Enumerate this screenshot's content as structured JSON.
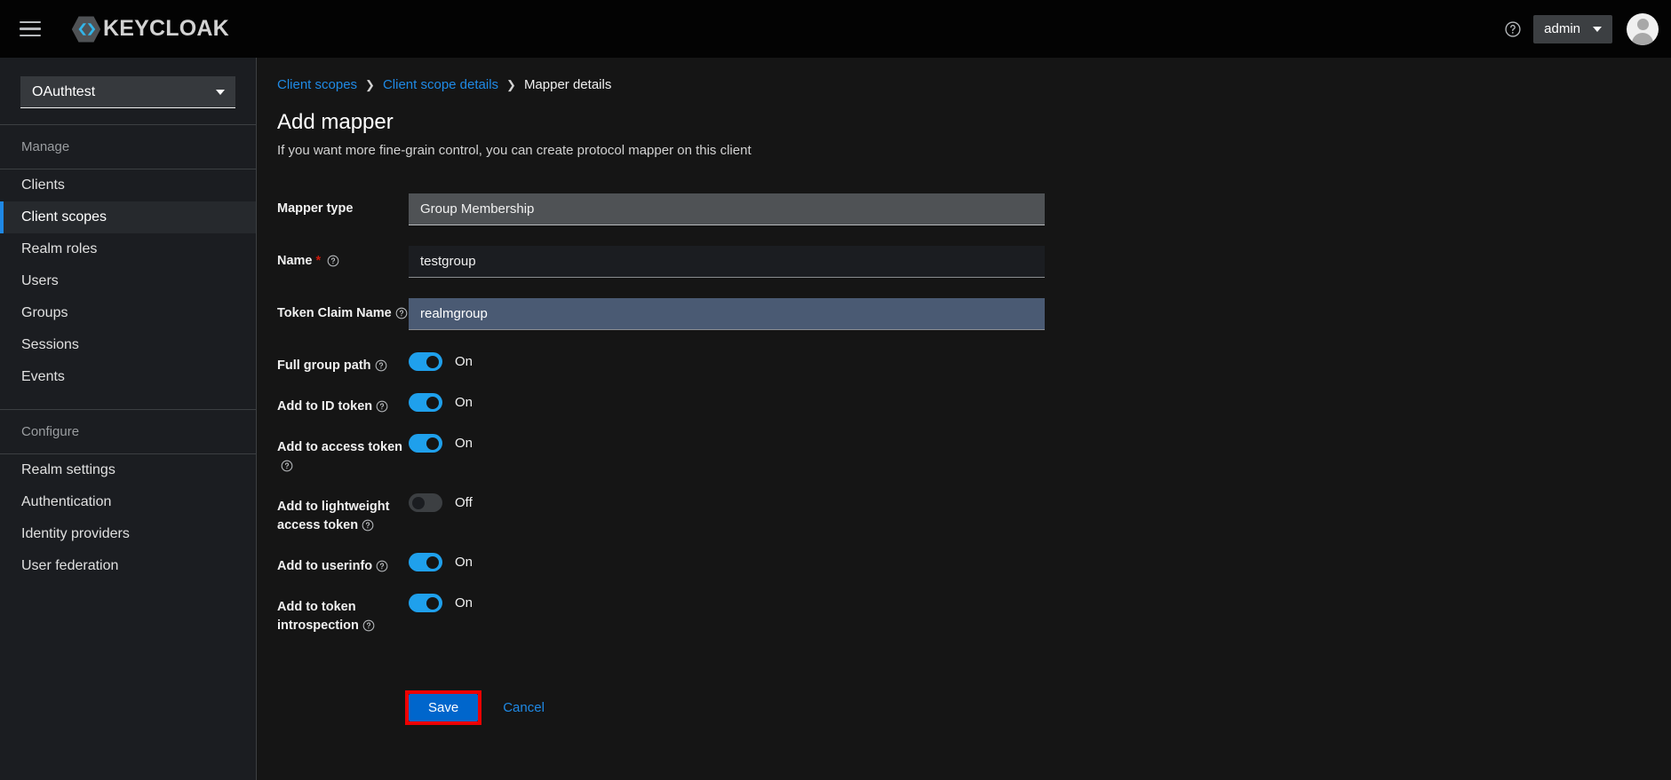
{
  "masthead": {
    "menu_icon": "hamburger-icon",
    "brand_name": "KEYCLOAK",
    "help_icon": "help-circle-icon",
    "user_name": "admin",
    "avatar_icon": "user-avatar-icon"
  },
  "sidebar": {
    "realm": {
      "selected": "OAuthtest",
      "caret_icon": "chevron-down-icon"
    },
    "manage": {
      "label": "Manage",
      "items": [
        {
          "label": "Clients",
          "active": false
        },
        {
          "label": "Client scopes",
          "active": true
        },
        {
          "label": "Realm roles",
          "active": false
        },
        {
          "label": "Users",
          "active": false
        },
        {
          "label": "Groups",
          "active": false
        },
        {
          "label": "Sessions",
          "active": false
        },
        {
          "label": "Events",
          "active": false
        }
      ]
    },
    "configure": {
      "label": "Configure",
      "items": [
        {
          "label": "Realm settings",
          "active": false
        },
        {
          "label": "Authentication",
          "active": false
        },
        {
          "label": "Identity providers",
          "active": false
        },
        {
          "label": "User federation",
          "active": false
        }
      ]
    }
  },
  "main": {
    "breadcrumb": [
      {
        "label": "Client scopes",
        "link": true
      },
      {
        "label": "Client scope details",
        "link": true
      },
      {
        "label": "Mapper details",
        "link": false
      }
    ],
    "breadcrumb_separator": "❯",
    "title": "Add mapper",
    "subtitle": "If you want more fine-grain control, you can create protocol mapper on this client",
    "fields": [
      {
        "label": "Mapper type",
        "required": false,
        "help": false,
        "value": "Group Membership",
        "placeholder": "",
        "state": "readonly"
      },
      {
        "label": "Name",
        "required": true,
        "help": true,
        "value": "testgroup",
        "placeholder": "",
        "state": "normal"
      },
      {
        "label": "Token Claim Name",
        "required": false,
        "help": true,
        "value": "realmgroup",
        "placeholder": "",
        "state": "focused"
      }
    ],
    "toggles": [
      {
        "label": "Full group path",
        "help": true,
        "on": true,
        "state_text": "On"
      },
      {
        "label": "Add to ID token",
        "help": true,
        "on": true,
        "state_text": "On"
      },
      {
        "label": "Add to access token",
        "help": true,
        "on": true,
        "state_text": "On"
      },
      {
        "label": "Add to lightweight access token",
        "help": true,
        "on": false,
        "state_text": "Off"
      },
      {
        "label": "Add to userinfo",
        "help": true,
        "on": true,
        "state_text": "On"
      },
      {
        "label": "Add to token introspection",
        "help": true,
        "on": true,
        "state_text": "On"
      }
    ],
    "actions": {
      "save_label": "Save",
      "cancel_label": "Cancel",
      "save_highlighted": true
    }
  },
  "colors": {
    "accent_blue": "#0066cc",
    "toggle_on": "#1fa0ec",
    "link_blue": "#1f8ae5",
    "highlight_red": "#ee0000",
    "required_red": "#c9190b",
    "sidebar_bg": "#1b1d21",
    "main_bg": "#151515",
    "masthead_bg": "#030303"
  }
}
